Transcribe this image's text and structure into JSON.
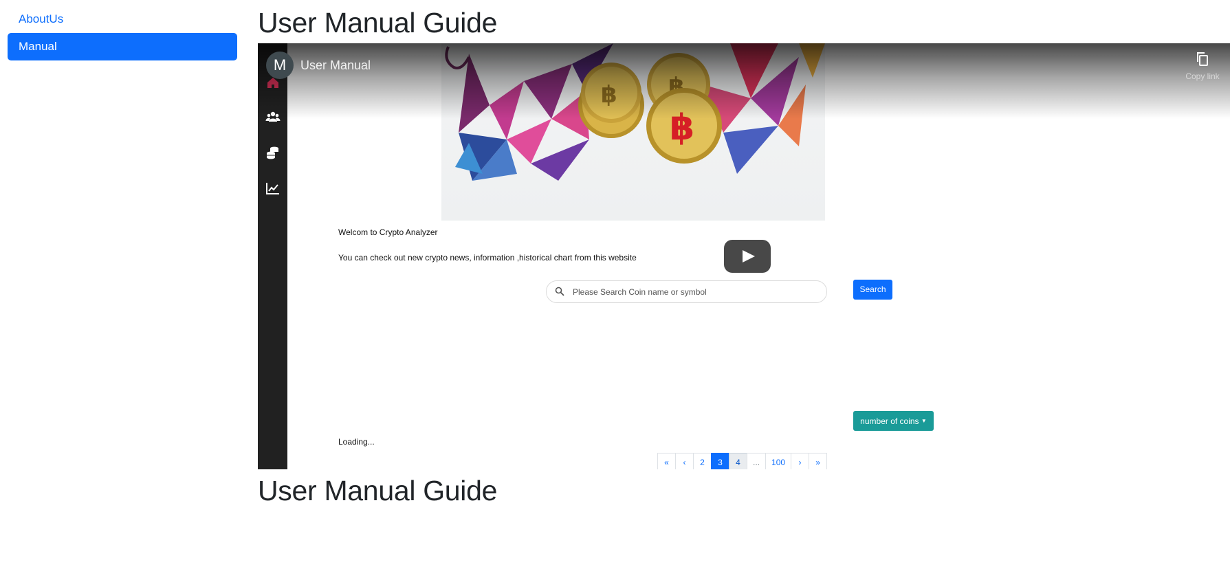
{
  "sidebar": {
    "items": [
      {
        "label": "AboutUs",
        "active": false
      },
      {
        "label": "Manual",
        "active": true
      }
    ]
  },
  "page": {
    "title_top": "User Manual Guide",
    "title_bottom": "User Manual Guide"
  },
  "video": {
    "channel_initial": "M",
    "title": "User Manual",
    "copy_link_label": "Copy link",
    "app": {
      "welcome": "Welcom to Crypto Analyzer",
      "description": "You can check out new crypto news, information ,historical chart from this website",
      "search_placeholder": "Please Search Coin name or symbol",
      "search_button": "Search",
      "coins_dropdown": "number of coins",
      "loading": "Loading...",
      "pagination": [
        "«",
        "‹",
        "2",
        "3",
        "4",
        "...",
        "100",
        "›",
        "»"
      ],
      "active_page": "3",
      "sidebar_icons": [
        "home-icon",
        "users-icon",
        "coins-icon",
        "chart-icon"
      ]
    }
  },
  "colors": {
    "primary": "#0d6efd",
    "teal": "#1a9b98",
    "dark_sidebar": "#212121",
    "heading": "#212529"
  }
}
